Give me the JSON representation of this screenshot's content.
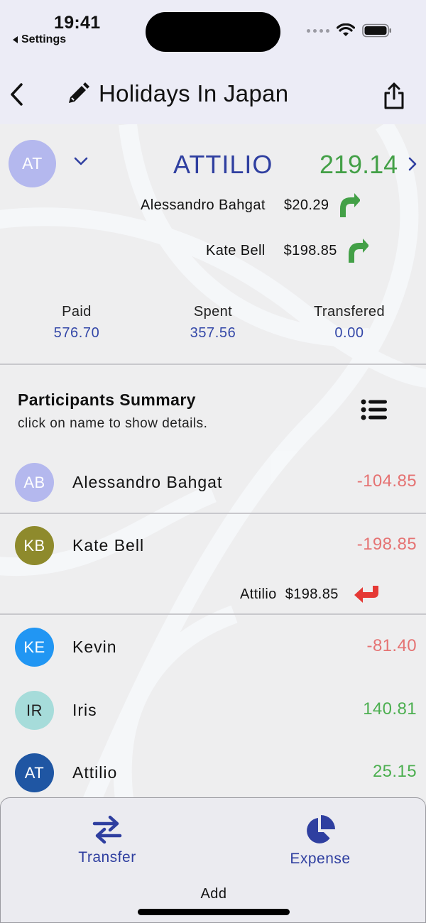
{
  "status": {
    "time": "19:41",
    "back_app": "Settings"
  },
  "nav": {
    "title": "Holidays In Japan"
  },
  "selected": {
    "initials": "AT",
    "name": "ATTILIO",
    "amount": "219.14",
    "avatar_color": "#b4b8ee",
    "debts": [
      {
        "name": "Alessandro Bahgat",
        "amount": "$20.29"
      },
      {
        "name": "Kate Bell",
        "amount": "$198.85"
      }
    ]
  },
  "stats": {
    "paid_label": "Paid",
    "paid_value": "576.70",
    "spent_label": "Spent",
    "spent_value": "357.56",
    "transfered_label": "Transfered",
    "transfered_value": "0.00"
  },
  "summary": {
    "title": "Participants Summary",
    "subtitle": "click on name to show details."
  },
  "participants": [
    {
      "initials": "AB",
      "name": "Alessandro Bahgat",
      "balance": "-104.85",
      "color": "#b4b8ee",
      "text_color": "#ffffff"
    },
    {
      "initials": "KB",
      "name": "Kate Bell",
      "balance": "-198.85",
      "color": "#8e8a2c",
      "text_color": "#ffffff"
    },
    {
      "initials": "KE",
      "name": "Kevin",
      "balance": "-81.40",
      "color": "#2196f3",
      "text_color": "#ffffff"
    },
    {
      "initials": "IR",
      "name": "Iris",
      "balance": "140.81",
      "color": "#a6dcda",
      "text_color": "#222222"
    },
    {
      "initials": "AT",
      "name": "Attilio",
      "balance": "25.15",
      "color": "#1f56a3",
      "text_color": "#ffffff"
    }
  ],
  "kate_detail": {
    "name": "Attilio",
    "amount": "$198.85"
  },
  "sheet": {
    "transfer_label": "Transfer",
    "expense_label": "Expense",
    "add_label": "Add"
  },
  "colors": {
    "accent": "#2f3fa0",
    "positive": "#4caf50",
    "negative": "#e57373",
    "arrow_up": "#43a047",
    "arrow_back": "#e53935"
  }
}
